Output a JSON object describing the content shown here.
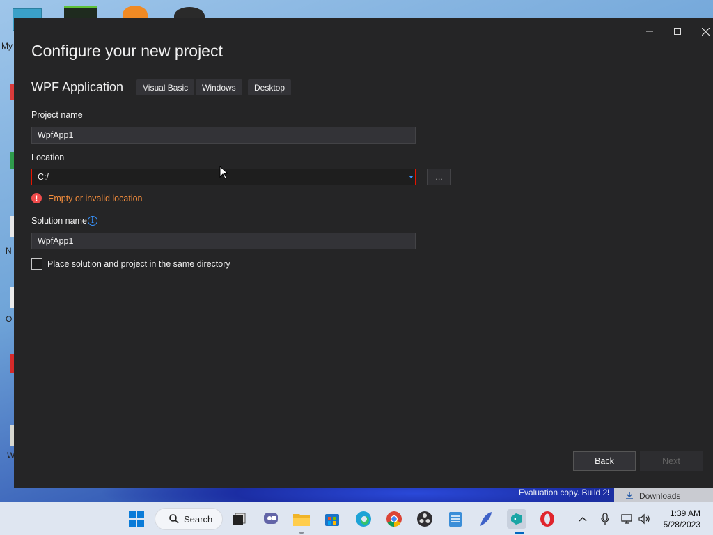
{
  "desktop": {
    "fragments": [
      "My",
      "N",
      "O",
      "W"
    ],
    "evaluation_text": "Evaluation copy. Build 25",
    "downloads_label": "Downloads"
  },
  "dialog": {
    "title": "Configure your new project",
    "template_name": "WPF Application",
    "tags": [
      "Visual Basic",
      "Windows",
      "Desktop"
    ],
    "project_name_label": "Project name",
    "project_name_value": "WpfApp1",
    "location_label": "Location",
    "location_value": "C:/",
    "browse_label": "...",
    "error_text": "Empty or invalid location",
    "solution_name_label": "Solution name",
    "solution_name_value": "WpfApp1",
    "same_dir_label": "Place solution and project in the same directory",
    "same_dir_checked": false,
    "back_label": "Back",
    "next_label": "Next"
  },
  "taskbar": {
    "search_label": "Search",
    "time": "1:39 AM",
    "date": "5/28/2023",
    "icons": [
      "windows-start-icon",
      "search-icon",
      "task-view-icon",
      "chat-icon",
      "file-explorer-icon",
      "store-icon",
      "edge-icon",
      "chrome-icon",
      "obs-icon",
      "notepad-icon",
      "feather-app-icon",
      "visual-studio-installer-icon",
      "opera-icon"
    ],
    "accent": "#0067c0"
  },
  "colors": {
    "dialog_bg": "#252526",
    "input_bg": "#333337",
    "error_border": "#e51400",
    "error_text": "#f28c3c",
    "info_blue": "#3794ff"
  }
}
